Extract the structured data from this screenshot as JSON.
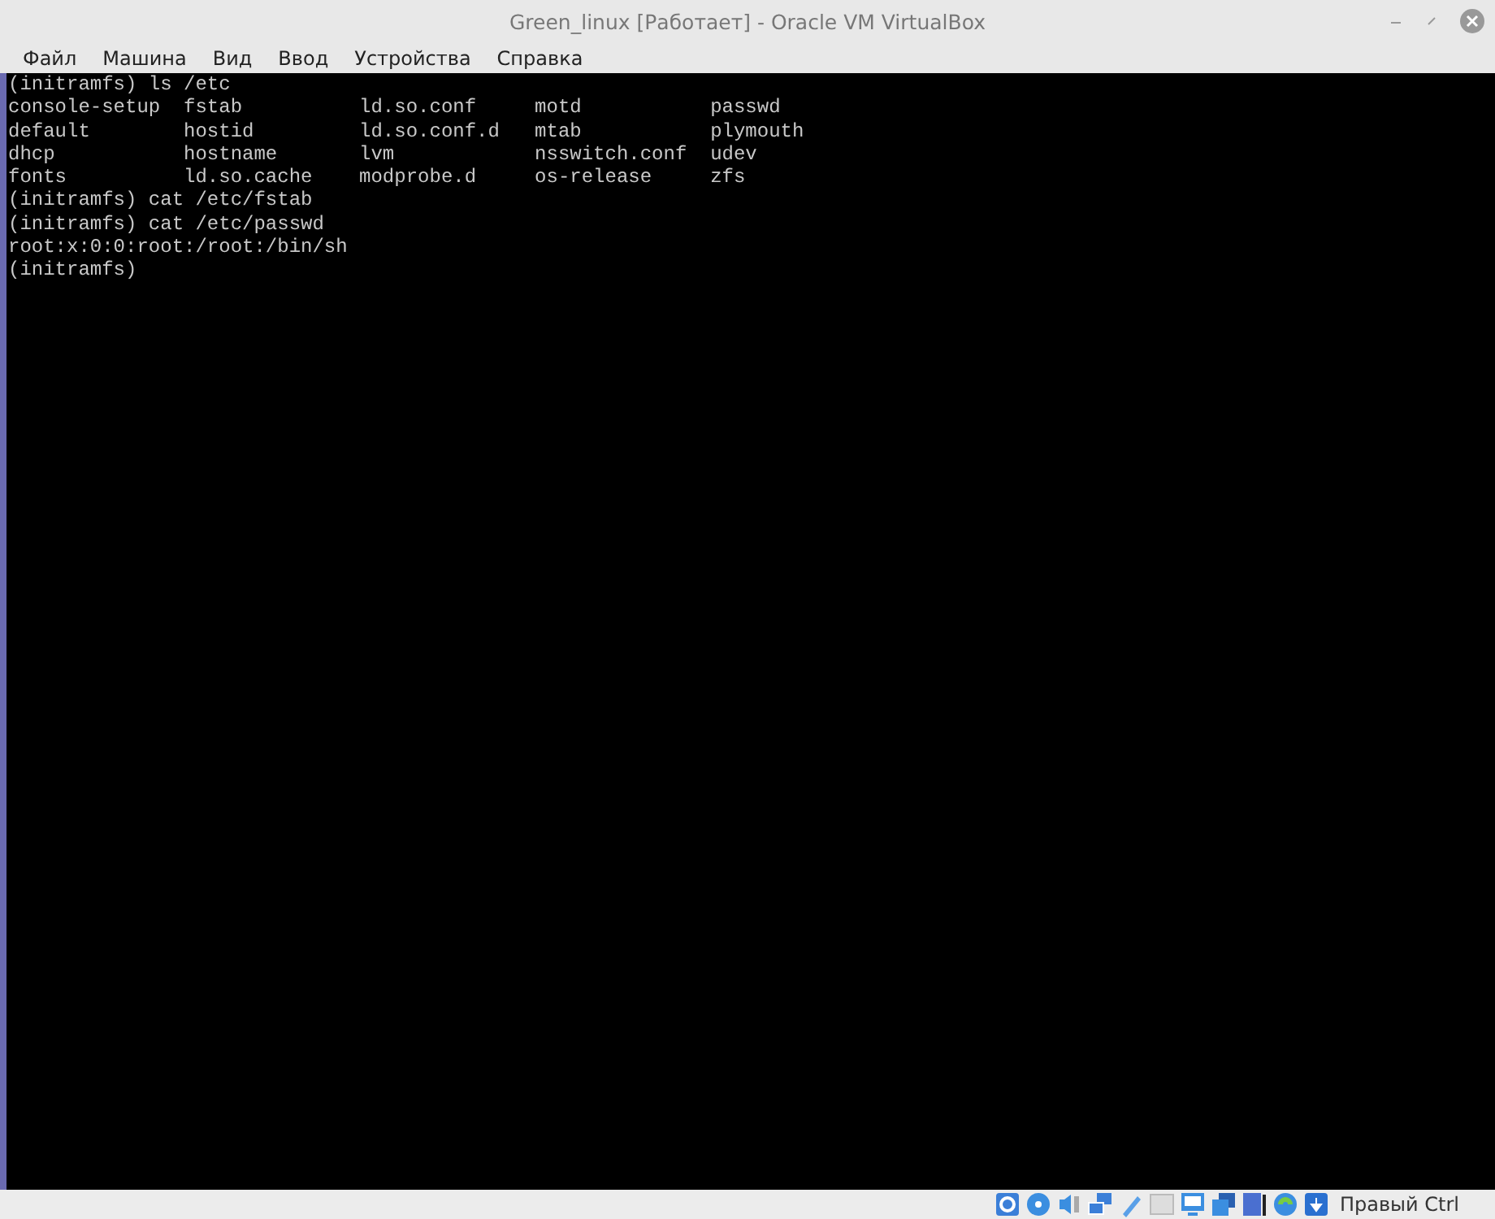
{
  "window": {
    "title": "Green_linux [Работает] - Oracle VM VirtualBox"
  },
  "menu": [
    "Файл",
    "Машина",
    "Вид",
    "Ввод",
    "Устройства",
    "Справка"
  ],
  "console": {
    "blocks": [
      {
        "kind": "line",
        "text": "(initramfs) ls /etc"
      },
      {
        "kind": "columns",
        "rows": [
          [
            "console-setup",
            "fstab",
            "ld.so.conf",
            "motd",
            "passwd"
          ],
          [
            "default",
            "hostid",
            "ld.so.conf.d",
            "mtab",
            "plymouth"
          ],
          [
            "dhcp",
            "hostname",
            "lvm",
            "nsswitch.conf",
            "udev"
          ],
          [
            "fonts",
            "ld.so.cache",
            "modprobe.d",
            "os-release",
            "zfs"
          ]
        ]
      },
      {
        "kind": "line",
        "text": "(initramfs) cat /etc/fstab"
      },
      {
        "kind": "line",
        "text": "(initramfs) cat /etc/passwd"
      },
      {
        "kind": "line",
        "text": "root:x:0:0:root:/root:/bin/sh"
      },
      {
        "kind": "line",
        "text": "(initramfs)"
      }
    ]
  },
  "status_bar": {
    "host_key": "Правый Ctrl"
  }
}
